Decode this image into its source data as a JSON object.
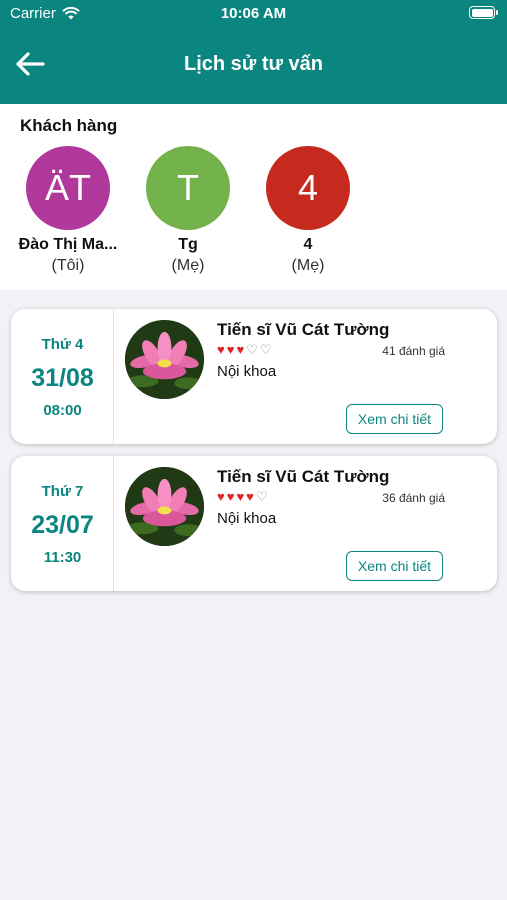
{
  "status_bar": {
    "carrier": "Carrier",
    "time": "10:06 AM"
  },
  "nav": {
    "title": "Lịch sử tư vấn"
  },
  "customers": {
    "title": "Khách hàng",
    "items": [
      {
        "initials": "ÄT",
        "name": "Đào Thị Ma...",
        "relation": "(Tôi)",
        "color": "#b0389a"
      },
      {
        "initials": "T",
        "name": "Tg",
        "relation": "(Mẹ)",
        "color": "#74b34c"
      },
      {
        "initials": "4",
        "name": "4",
        "relation": "(Mẹ)",
        "color": "#c62a1f"
      }
    ]
  },
  "consultations": [
    {
      "weekday": "Thứ 4",
      "date": "31/08",
      "time": "08:00",
      "doctor": "Tiến sĩ Vũ Cát Tường",
      "rating": 3,
      "rating_max": 5,
      "reviews": "41 đánh giá",
      "specialty": "Nội khoa",
      "button": "Xem chi tiết",
      "photo_icon": "lotus-flower"
    },
    {
      "weekday": "Thứ 7",
      "date": "23/07",
      "time": "11:30",
      "doctor": "Tiến sĩ Vũ Cát Tường",
      "rating": 4,
      "rating_max": 5,
      "reviews": "36 đánh giá",
      "specialty": "Nội khoa",
      "button": "Xem chi tiết",
      "photo_icon": "lotus-flower"
    }
  ],
  "colors": {
    "primary": "#0b8580",
    "heart": "#e02424"
  }
}
